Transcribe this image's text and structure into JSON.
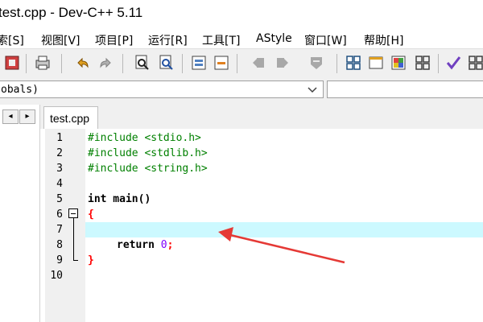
{
  "window": {
    "title": "test.cpp - Dev-C++ 5.11"
  },
  "menu": [
    {
      "label": "索[S]"
    },
    {
      "label": "视图[V]"
    },
    {
      "label": "项目[P]"
    },
    {
      "label": "运行[R]"
    },
    {
      "label": "工具[T]"
    },
    {
      "label": "AStyle"
    },
    {
      "label": "窗口[W]"
    },
    {
      "label": "帮助[H]"
    }
  ],
  "combo": {
    "value": "obals)"
  },
  "nav": {
    "prev": "◂",
    "next": "▸"
  },
  "tab": {
    "label": "test.cpp"
  },
  "editor": {
    "line_numbers": [
      "1",
      "2",
      "3",
      "4",
      "5",
      "6",
      "7",
      "8",
      "9",
      "10"
    ],
    "code": {
      "l1": "#include <stdio.h>",
      "l2": "#include <stdlib.h>",
      "l3": "#include <string.h>",
      "l5_kw": "int",
      "l5_rest": " main()",
      "l6": "{",
      "l8_kw": "return",
      "l8_num": "0",
      "l8_end": ";",
      "l9": "}"
    },
    "current_line": 7,
    "highlight_color": "#ccf9ff"
  },
  "annotation": {
    "arrow_color": "#e53935"
  }
}
